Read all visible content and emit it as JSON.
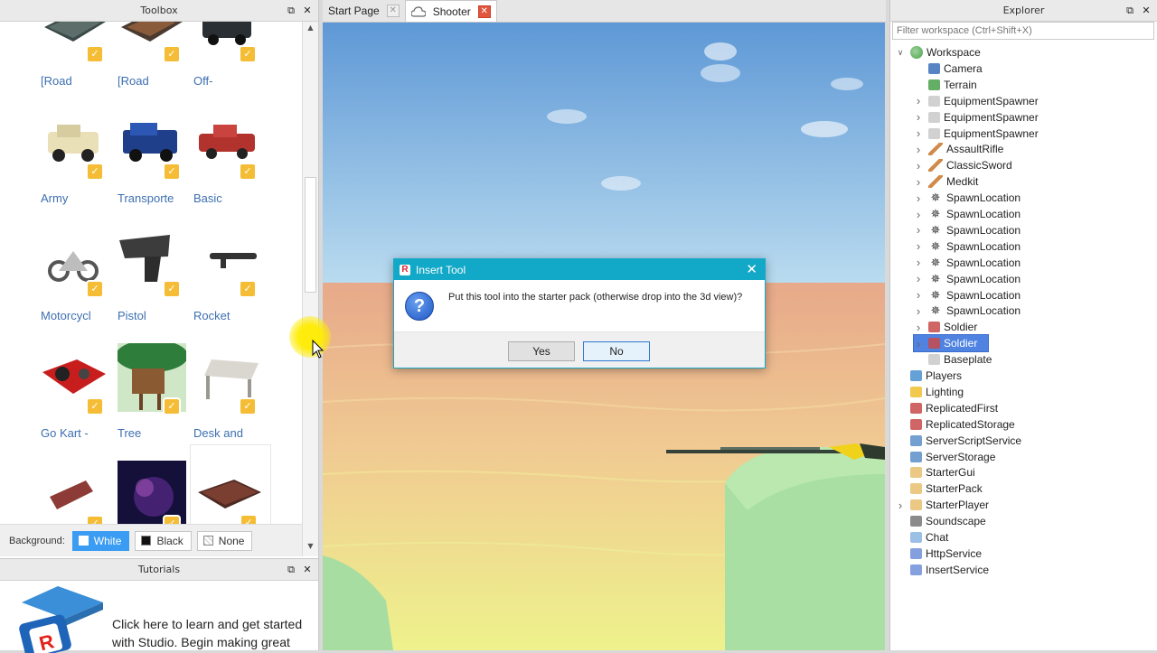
{
  "toolbox": {
    "title": "Toolbox",
    "items": [
      {
        "label": "[Road"
      },
      {
        "label": "[Road"
      },
      {
        "label": "Off-"
      },
      {
        "label": "Army"
      },
      {
        "label": "Transporte"
      },
      {
        "label": "Basic"
      },
      {
        "label": "Motorcycl"
      },
      {
        "label": "Pistol"
      },
      {
        "label": "Rocket"
      },
      {
        "label": "Go Kart -"
      },
      {
        "label": "Tree"
      },
      {
        "label": "Desk and"
      },
      {
        "label": ""
      },
      {
        "label": ""
      },
      {
        "label": ""
      }
    ],
    "background_label": "Background:",
    "bg_options": [
      {
        "label": "White",
        "color": "#ffffff"
      },
      {
        "label": "Black",
        "color": "#111111"
      },
      {
        "label": "None",
        "color": "#e8e8e8"
      }
    ]
  },
  "tutorials": {
    "title": "Tutorials",
    "text": "Click here to learn and get started with Studio. Begin making great"
  },
  "tabs": [
    {
      "label": "Start Page"
    },
    {
      "label": "Shooter"
    }
  ],
  "dialog": {
    "title": "Insert Tool",
    "message": "Put this tool into the starter pack (otherwise drop into the 3d view)?",
    "yes": "Yes",
    "no": "No"
  },
  "explorer": {
    "title": "Explorer",
    "filter_placeholder": "Filter workspace (Ctrl+Shift+X)",
    "tree": [
      {
        "label": "Workspace",
        "icon": "globe",
        "depth": 0,
        "expander": "expanded"
      },
      {
        "label": "Camera",
        "icon": "camera",
        "depth": 1,
        "expander": ""
      },
      {
        "label": "Terrain",
        "icon": "terrain",
        "depth": 1,
        "expander": ""
      },
      {
        "label": "EquipmentSpawner",
        "icon": "part",
        "depth": 1,
        "expander": "collapsed"
      },
      {
        "label": "EquipmentSpawner",
        "icon": "part",
        "depth": 1,
        "expander": "collapsed"
      },
      {
        "label": "EquipmentSpawner",
        "icon": "part",
        "depth": 1,
        "expander": "collapsed"
      },
      {
        "label": "AssaultRifle",
        "icon": "tool",
        "depth": 1,
        "expander": "collapsed"
      },
      {
        "label": "ClassicSword",
        "icon": "tool",
        "depth": 1,
        "expander": "collapsed"
      },
      {
        "label": "Medkit",
        "icon": "tool",
        "depth": 1,
        "expander": "collapsed"
      },
      {
        "label": "SpawnLocation",
        "icon": "spawn",
        "depth": 1,
        "expander": "collapsed"
      },
      {
        "label": "SpawnLocation",
        "icon": "spawn",
        "depth": 1,
        "expander": "collapsed"
      },
      {
        "label": "SpawnLocation",
        "icon": "spawn",
        "depth": 1,
        "expander": "collapsed"
      },
      {
        "label": "SpawnLocation",
        "icon": "spawn",
        "depth": 1,
        "expander": "collapsed"
      },
      {
        "label": "SpawnLocation",
        "icon": "spawn",
        "depth": 1,
        "expander": "collapsed"
      },
      {
        "label": "SpawnLocation",
        "icon": "spawn",
        "depth": 1,
        "expander": "collapsed"
      },
      {
        "label": "SpawnLocation",
        "icon": "spawn",
        "depth": 1,
        "expander": "collapsed"
      },
      {
        "label": "SpawnLocation",
        "icon": "spawn",
        "depth": 1,
        "expander": "collapsed"
      },
      {
        "label": "Soldier",
        "icon": "model",
        "depth": 1,
        "expander": "collapsed"
      },
      {
        "label": "Soldier",
        "icon": "model",
        "depth": 1,
        "expander": "collapsed",
        "selected": true
      },
      {
        "label": "Baseplate",
        "icon": "part",
        "depth": 1,
        "expander": ""
      },
      {
        "label": "Players",
        "icon": "players",
        "depth": 0,
        "expander": ""
      },
      {
        "label": "Lighting",
        "icon": "lighting",
        "depth": 0,
        "expander": ""
      },
      {
        "label": "ReplicatedFirst",
        "icon": "replicated",
        "depth": 0,
        "expander": ""
      },
      {
        "label": "ReplicatedStorage",
        "icon": "replicated",
        "depth": 0,
        "expander": ""
      },
      {
        "label": "ServerScriptService",
        "icon": "server",
        "depth": 0,
        "expander": ""
      },
      {
        "label": "ServerStorage",
        "icon": "server",
        "depth": 0,
        "expander": ""
      },
      {
        "label": "StarterGui",
        "icon": "folder",
        "depth": 0,
        "expander": ""
      },
      {
        "label": "StarterPack",
        "icon": "folder",
        "depth": 0,
        "expander": ""
      },
      {
        "label": "StarterPlayer",
        "icon": "folder",
        "depth": 0,
        "expander": "collapsed"
      },
      {
        "label": "Soundscape",
        "icon": "sound",
        "depth": 0,
        "expander": ""
      },
      {
        "label": "Chat",
        "icon": "chat",
        "depth": 0,
        "expander": ""
      },
      {
        "label": "HttpService",
        "icon": "service",
        "depth": 0,
        "expander": ""
      },
      {
        "label": "InsertService",
        "icon": "service",
        "depth": 0,
        "expander": ""
      }
    ]
  },
  "colors": {
    "dialog_title": "#12a8c7",
    "selection": "#4f82e1",
    "toolbox_link": "#3d6fb0",
    "badge": "#f5bd35"
  }
}
